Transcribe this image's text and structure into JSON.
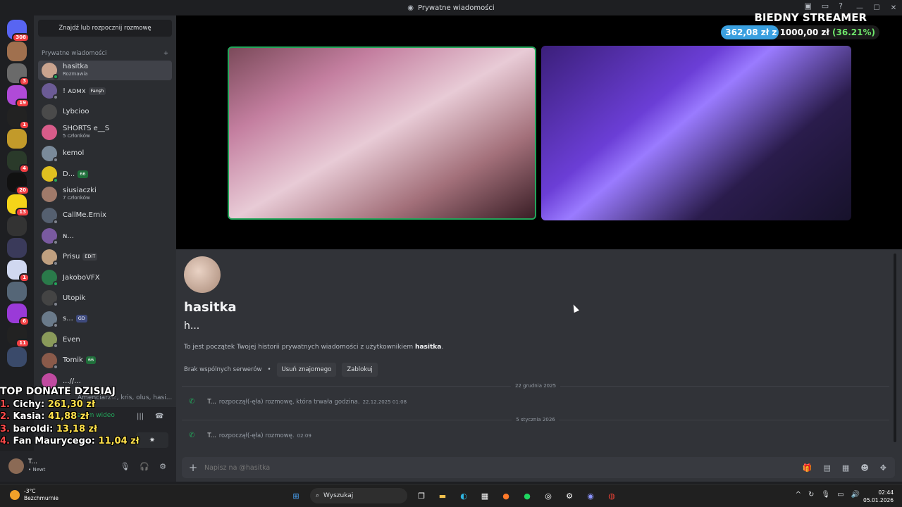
{
  "window": {
    "title": "Prywatne wiadomości"
  },
  "servers": [
    {
      "label": "",
      "badge": "308",
      "color": "#5865f2",
      "icon": "discord-logo-icon"
    },
    {
      "label": "",
      "badge": "",
      "color": "#a0704e",
      "icon": "avatar-icon"
    },
    {
      "label": "",
      "badge": "3",
      "color": "#6a6a6a",
      "icon": "server-icon"
    },
    {
      "label": "",
      "badge": "19",
      "color": "#b04ad8",
      "icon": "server-icon"
    },
    {
      "label": "",
      "badge": "1",
      "color": "#222222",
      "icon": "server-icon"
    },
    {
      "label": "",
      "badge": "",
      "color": "#c29a2a",
      "icon": "server-icon"
    },
    {
      "label": "",
      "badge": "4",
      "color": "#2a3a2a",
      "icon": "server-icon"
    },
    {
      "label": "",
      "badge": "20",
      "color": "#111111",
      "icon": "server-icon"
    },
    {
      "label": "",
      "badge": "13",
      "color": "#f4d419",
      "icon": "server-icon"
    },
    {
      "label": "",
      "badge": "",
      "color": "#333333",
      "icon": "server-icon"
    },
    {
      "label": "",
      "badge": "",
      "color": "#3a3a5a",
      "icon": "server-icon"
    },
    {
      "label": "",
      "badge": "1",
      "color": "#d0d8f0",
      "icon": "server-icon"
    },
    {
      "label": "",
      "badge": "",
      "color": "#556677",
      "icon": "server-icon"
    },
    {
      "label": "",
      "badge": "6",
      "color": "#9a3ad8",
      "icon": "server-icon"
    },
    {
      "label": "",
      "badge": "11",
      "color": "#222222",
      "icon": "server-icon"
    },
    {
      "label": "",
      "badge": "",
      "color": "#3a4a6a",
      "icon": "server-icon"
    }
  ],
  "dm": {
    "find_label": "Znajdź lub rozpocznij rozmowę",
    "header": "Prywatne wiadomości",
    "list": [
      {
        "name": "hasitka",
        "sub": "Rozmawia",
        "tag": "",
        "color": "#c9a38e",
        "status": "on"
      },
      {
        "name": "! ᴀᴅᴍx",
        "sub": "",
        "tag": "Fanşh",
        "color": "#6b5b95",
        "status": "off"
      },
      {
        "name": "Lybcioo",
        "sub": "",
        "tag": "",
        "color": "#4a4a4a",
        "status": "none"
      },
      {
        "name": "SHORTS e__S",
        "sub": "5 członków",
        "tag": "",
        "color": "#d85c8a",
        "status": "none"
      },
      {
        "name": "kemol",
        "sub": "",
        "tag": "",
        "color": "#7a8a9a",
        "status": "off"
      },
      {
        "name": "D...",
        "sub": "",
        "tag": "66",
        "color": "#e0c020",
        "status": "on"
      },
      {
        "name": "siusiaczki",
        "sub": "7 członków",
        "tag": "",
        "color": "#a07a6a",
        "status": "none"
      },
      {
        "name": "CallMe.Ernix",
        "sub": "",
        "tag": "",
        "color": "#556070",
        "status": "off"
      },
      {
        "name": "ɴ...",
        "sub": "",
        "tag": "",
        "color": "#7a5aa0",
        "status": "off"
      },
      {
        "name": "Prisu",
        "sub": "",
        "tag": "EDIT",
        "color": "#c0a080",
        "status": "off"
      },
      {
        "name": "JakoboVFX",
        "sub": "",
        "tag": "",
        "color": "#2a7a4a",
        "status": "on"
      },
      {
        "name": "Utopik",
        "sub": "",
        "tag": "",
        "color": "#444444",
        "status": "off"
      },
      {
        "name": "s...",
        "sub": "",
        "tag": "GD",
        "color": "#6a7a8a",
        "status": "off"
      },
      {
        "name": "Even",
        "sub": "",
        "tag": "",
        "color": "#8a9a5a",
        "status": "off"
      },
      {
        "name": "Tomik",
        "sub": "",
        "tag": "66",
        "color": "#8a5a4a",
        "status": "off"
      },
      {
        "name": "...//...",
        "sub": "",
        "tag": "",
        "color": "#c04aa0",
        "status": "none"
      }
    ],
    "partial": "Amenciarz☆, kris, olus, hasi..."
  },
  "voice": {
    "status": "atem wideo"
  },
  "user": {
    "name": "T...",
    "status": "• Newt"
  },
  "donate": {
    "title": "TOP DONATE DZISIAJ",
    "rows": [
      {
        "n": "1.",
        "name": "Cichy:",
        "value": "261,30 zł"
      },
      {
        "n": "2.",
        "name": "Kasia:",
        "value": "41,88 zł"
      },
      {
        "n": "3.",
        "name": "baroldi:",
        "value": "13,18 zł"
      },
      {
        "n": "4.",
        "name": "Fan Maurycego:",
        "value": "11,04 zł"
      }
    ]
  },
  "streamer": {
    "title": "BIEDNY STREAMER",
    "current": "362,08 zł",
    "sep": "z",
    "goal": "1000,00 zł",
    "pct": "(36.21%)",
    "fraction": 0.3621
  },
  "profile": {
    "name": "hasitka",
    "username": "h...",
    "intro_pre": "To jest początek Twojej historii prywatnych wiadomości z użytkownikiem ",
    "intro_user": "hasitka",
    "intro_post": ".",
    "no_servers": "Brak wspólnych serwerów",
    "remove_friend": "Usuń znajomego",
    "block": "Zablokuj"
  },
  "messages": [
    {
      "date": "22 grudnia 2025",
      "who": "T...",
      "text": "rozpoczął(-ęła) rozmowę, która trwała godzina.",
      "time": "22.12.2025 01:08"
    },
    {
      "date": "5 stycznia 2026",
      "who": "T...",
      "text": "rozpoczął(-ęła) rozmowę.",
      "time": "02:09"
    }
  ],
  "input": {
    "placeholder": "Napisz na @hasitka"
  },
  "taskbar": {
    "temp": "-3°C",
    "weather": "Bezchmurnie",
    "search": "Wyszukaj",
    "time": "02:44",
    "date": "05.01.2026"
  }
}
